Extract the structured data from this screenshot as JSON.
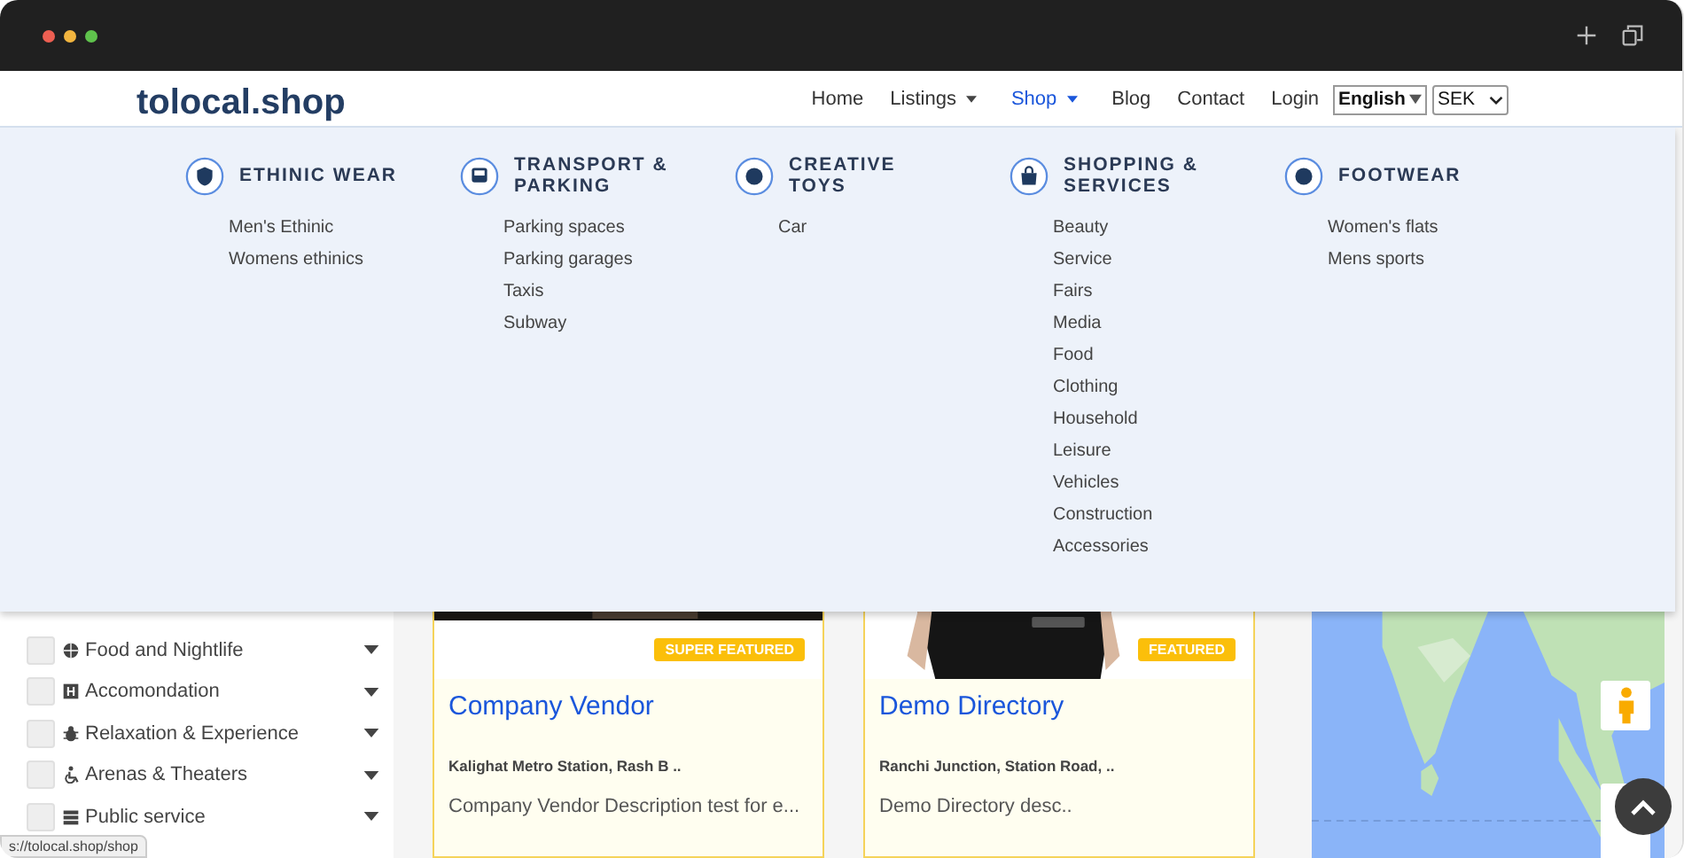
{
  "header": {
    "logo": "tolocal.shop",
    "nav": [
      {
        "label": "Home",
        "selected": false,
        "has_caret": false
      },
      {
        "label": "Listings",
        "selected": false,
        "has_caret": true
      },
      {
        "label": "Shop",
        "selected": true,
        "has_caret": true
      },
      {
        "label": "Blog",
        "selected": false,
        "has_caret": false
      },
      {
        "label": "Contact",
        "selected": false,
        "has_caret": false
      },
      {
        "label": "Login",
        "selected": false,
        "has_caret": false
      }
    ],
    "language_select": {
      "value": "English"
    },
    "currency_select": {
      "value": "SEK"
    }
  },
  "mega_menu": {
    "columns": [
      {
        "heading": "ETHINIC WEAR",
        "items": [
          "Men's Ethinic",
          "Womens ethinics"
        ]
      },
      {
        "heading": "TRANSPORT & PARKING",
        "items": [
          "Parking spaces",
          "Parking garages",
          "Taxis",
          "Subway"
        ]
      },
      {
        "heading": "CREATIVE TOYS",
        "items": [
          "Car"
        ]
      },
      {
        "heading": "SHOPPING & SERVICES",
        "items": [
          "Beauty",
          "Service",
          "Fairs",
          "Media",
          "Food",
          "Clothing",
          "Household",
          "Leisure",
          "Vehicles",
          "Construction",
          "Accessories"
        ]
      },
      {
        "heading": "FOOTWEAR",
        "items": [
          "Women's flats",
          "Mens sports"
        ]
      }
    ]
  },
  "sidebar": {
    "categories": [
      {
        "label": "Food and Nightlife",
        "checked": false
      },
      {
        "label": "Accomondation",
        "checked": false
      },
      {
        "label": "Relaxation & Experience",
        "checked": false
      },
      {
        "label": "Arenas & Theaters",
        "checked": false
      },
      {
        "label": "Public service",
        "checked": false
      }
    ]
  },
  "listings": [
    {
      "badge": "SUPER FEATURED",
      "title": "Company Vendor",
      "address": "Kalighat Metro Station, Rash B ..",
      "description": "Company Vendor Description test for e..."
    },
    {
      "badge": "FEATURED",
      "title": "Demo Directory",
      "address": "Ranchi Junction, Station Road, ..",
      "description": "Demo Directory desc.."
    }
  ],
  "status_url": "s://tolocal.shop/shop"
}
